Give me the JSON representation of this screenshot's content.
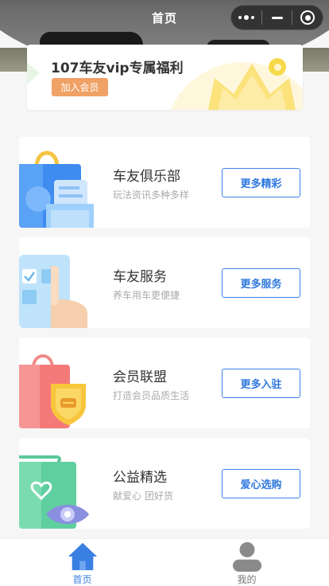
{
  "navbar": {
    "title": "首页"
  },
  "vip": {
    "title": "107车友vip专属福利",
    "button": "加入会员"
  },
  "cards": [
    {
      "title": "车友俱乐部",
      "subtitle": "玩法资讯多种多样",
      "button": "更多精彩",
      "icon": "shopping-bag-icon"
    },
    {
      "title": "车友服务",
      "subtitle": "养车用车更便捷",
      "button": "更多服务",
      "icon": "tablet-tap-icon"
    },
    {
      "title": "会员联盟",
      "subtitle": "打造会员品质生活",
      "button": "更多入驻",
      "icon": "member-bag-icon"
    },
    {
      "title": "公益精选",
      "subtitle": "献爱心 团好货",
      "button": "爱心选购",
      "icon": "charity-bag-icon"
    }
  ],
  "tabbar": {
    "items": [
      {
        "label": "首页",
        "icon": "home-icon",
        "active": true
      },
      {
        "label": "我的",
        "icon": "user-icon",
        "active": false
      }
    ]
  },
  "colors": {
    "accent": "#2f78dd",
    "vip_button": "#f0a165",
    "tab_active": "#3a7fe2"
  }
}
